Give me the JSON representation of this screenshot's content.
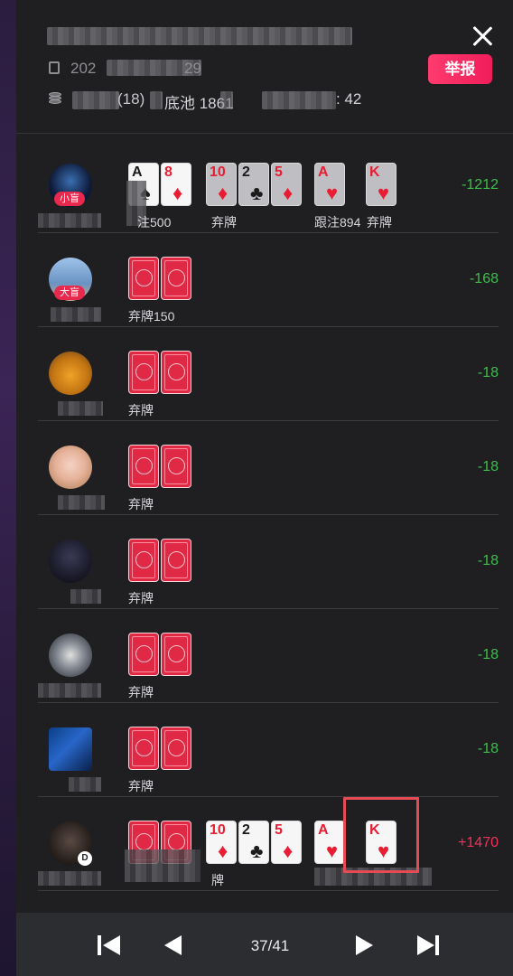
{
  "header": {
    "date_prefix": "202",
    "date_suffix": "29",
    "blinds_suffix": "(18)",
    "pot_label": "底池 1861",
    "hand_suffix": ": 42",
    "report_button": "举报"
  },
  "players": [
    {
      "badge": "小盲",
      "action": "注500",
      "action2": "弃牌",
      "street_actions": [
        "跟注894",
        "弃牌"
      ],
      "result": "-1212",
      "result_type": "neg"
    },
    {
      "badge": "大盲",
      "action": "弃牌150",
      "result": "-168",
      "result_type": "neg"
    },
    {
      "action": "弃牌",
      "result": "-18",
      "result_type": "neg"
    },
    {
      "action": "弃牌",
      "result": "-18",
      "result_type": "neg"
    },
    {
      "action": "弃牌",
      "result": "-18",
      "result_type": "neg"
    },
    {
      "action": "弃牌",
      "result": "-18",
      "result_type": "neg"
    },
    {
      "action": "弃牌",
      "result": "-18",
      "result_type": "neg"
    },
    {
      "badge_icon": "D",
      "action2": "牌",
      "result": "+1470",
      "result_type": "pos"
    }
  ],
  "cards": {
    "player1_hole": [
      {
        "rank": "A",
        "suit": "♠"
      },
      {
        "rank": "8",
        "suit": "♦"
      }
    ],
    "flop": [
      {
        "rank": "10",
        "suit": "♦"
      },
      {
        "rank": "2",
        "suit": "♣"
      },
      {
        "rank": "5",
        "suit": "♦"
      }
    ],
    "turn": {
      "rank": "A",
      "suit": "♥"
    },
    "river": {
      "rank": "K",
      "suit": "♥"
    }
  },
  "pagination": {
    "indicator": "37/41"
  },
  "colors": {
    "negative": "#3fbe4a",
    "positive": "#f0325a",
    "report": "#f01d5a",
    "card_back": "#e02a45",
    "highlight": "#e54b55"
  }
}
